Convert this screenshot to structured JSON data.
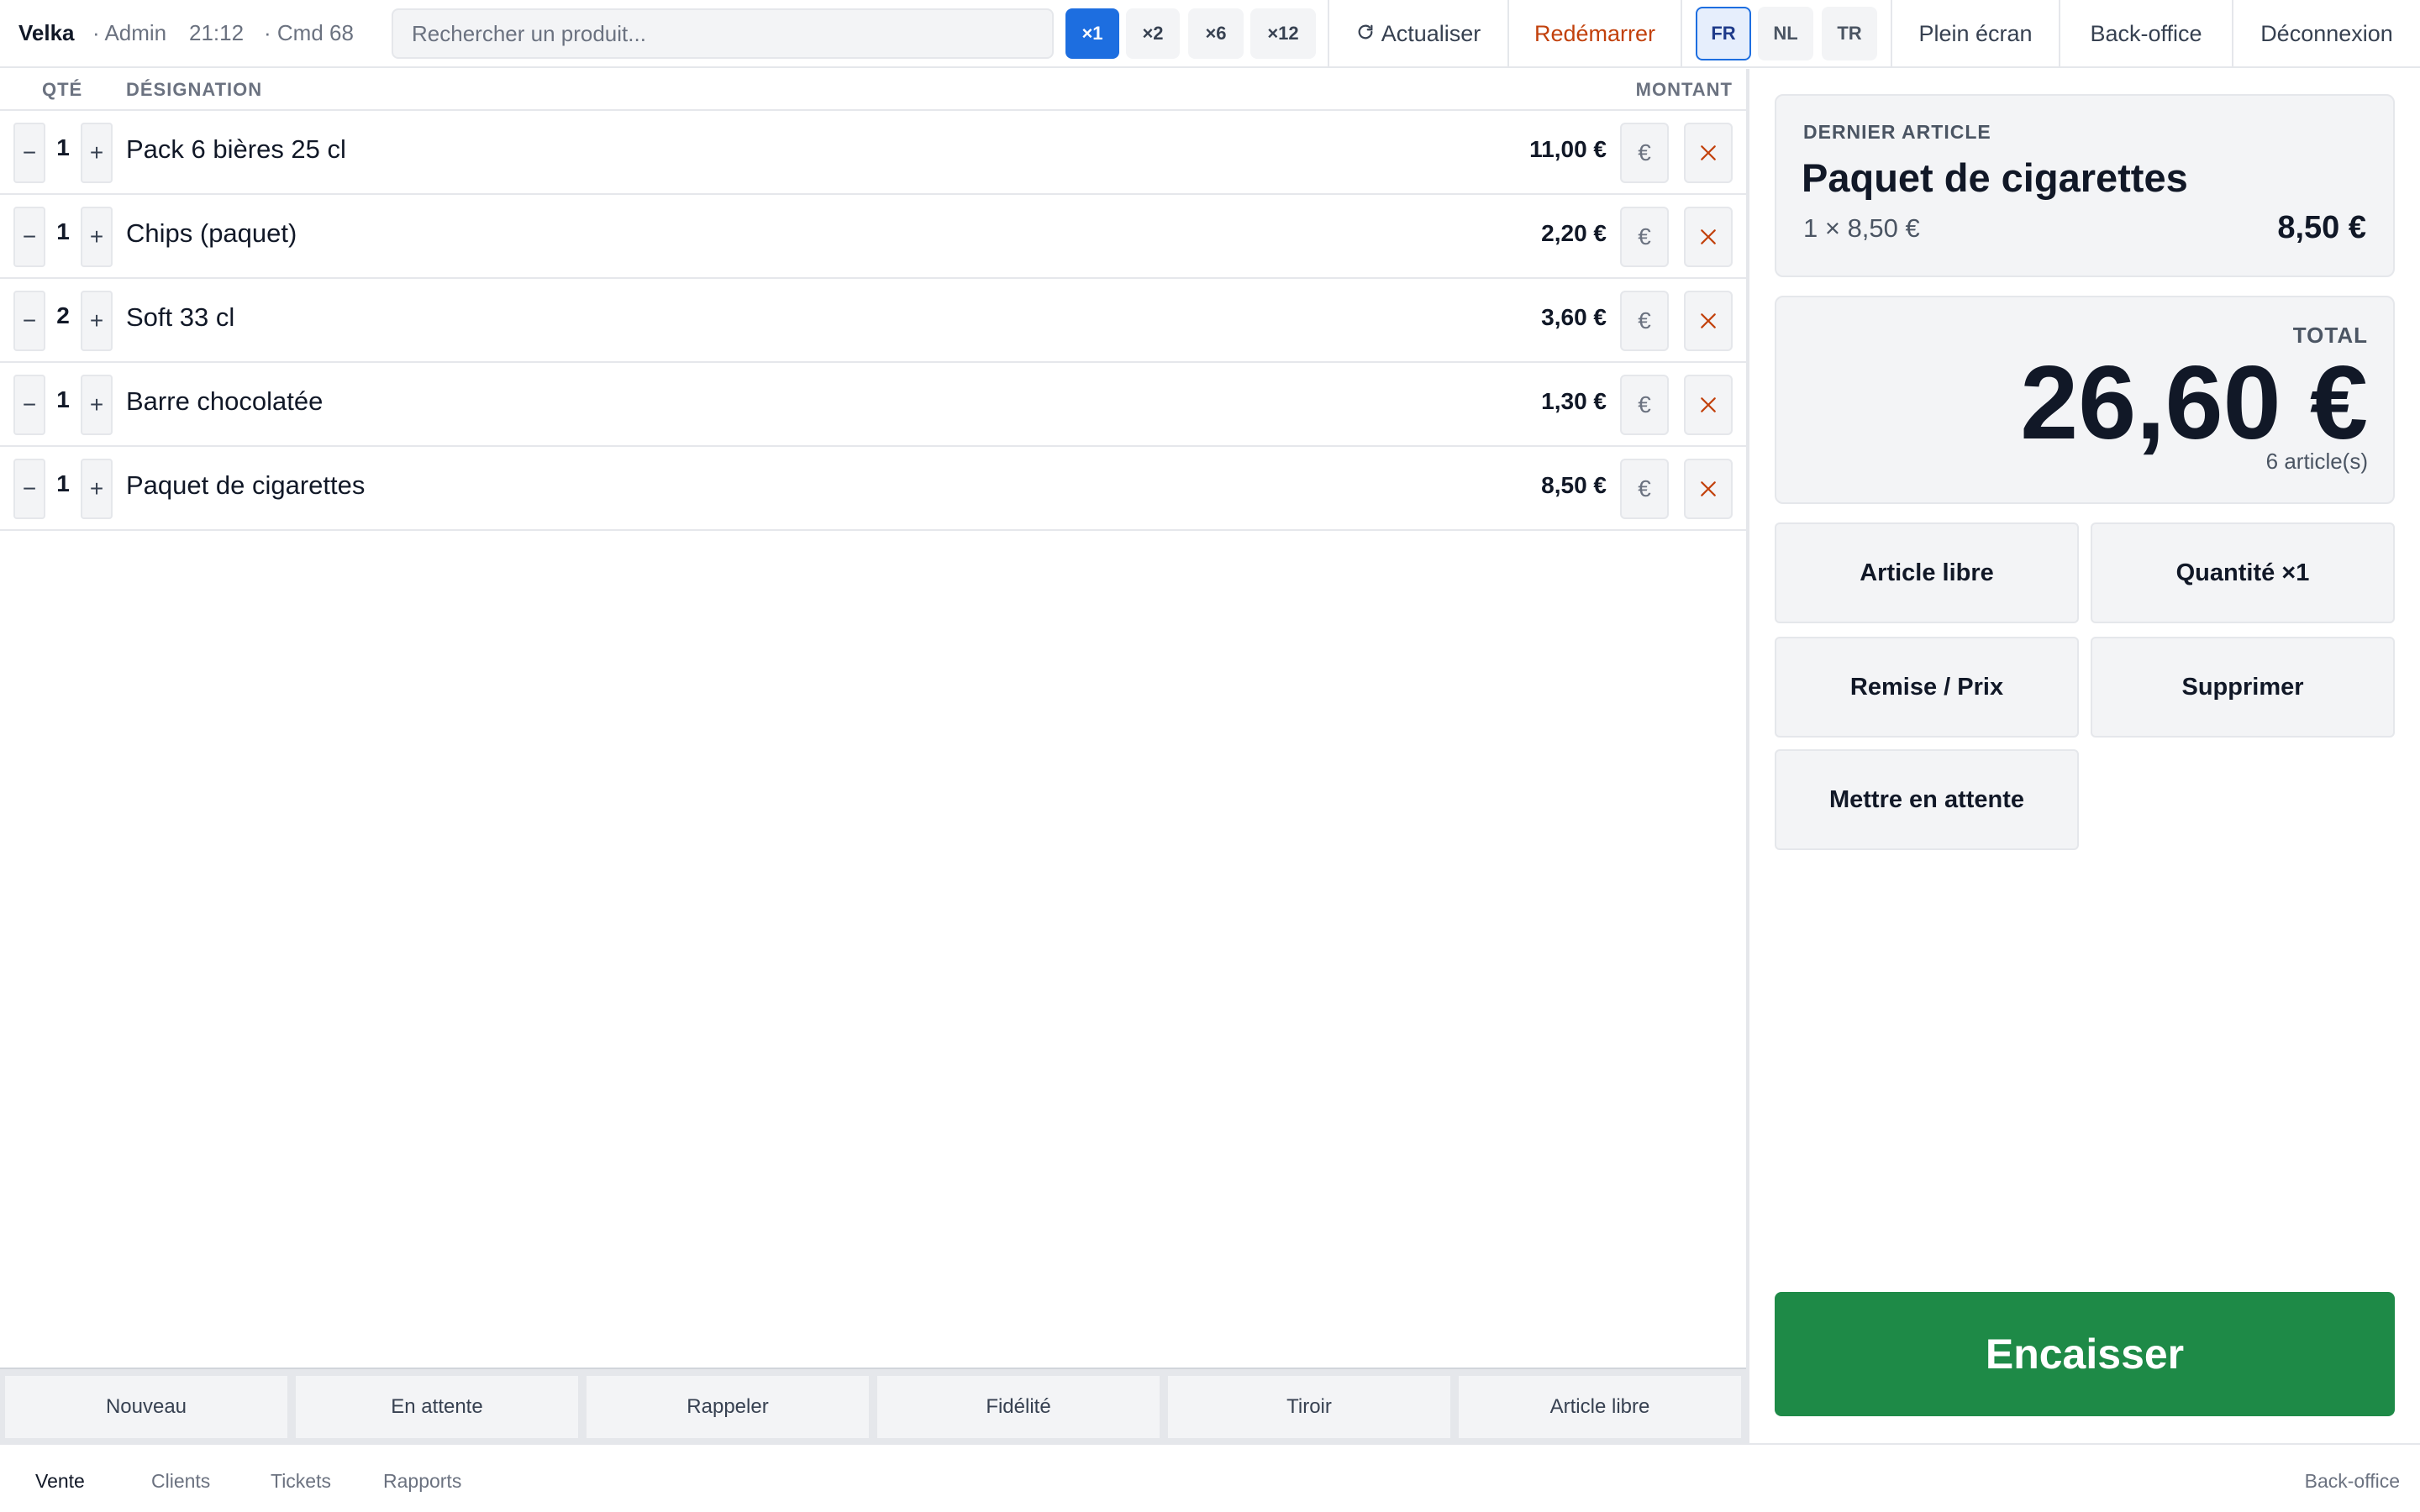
{
  "topbar": {
    "brand": "Velka",
    "user_text": "· Admin",
    "time": "21:12",
    "order_text": "· Cmd 68",
    "search_placeholder": "Rechercher un produit...",
    "multipliers": [
      "×1",
      "×2",
      "×6",
      "×12"
    ],
    "active_multiplier": "×1",
    "refresh_label": "Actualiser",
    "restart_label": "Redémarrer",
    "languages": [
      "FR",
      "NL",
      "TR"
    ],
    "active_language": "FR",
    "fullscreen_label": "Plein écran",
    "backoffice_label": "Back-office",
    "logout_label": "Déconnexion"
  },
  "ticket": {
    "headers": {
      "qty": "QTÉ",
      "designation": "DÉSIGNATION",
      "amount": "MONTANT"
    },
    "decrement_glyph": "−",
    "increment_glyph": "+",
    "price_glyph": "€",
    "lines": [
      {
        "qty": "1",
        "name": "Pack 6 bières 25 cl",
        "amount": "11,00 €"
      },
      {
        "qty": "1",
        "name": "Chips (paquet)",
        "amount": "2,20 €"
      },
      {
        "qty": "2",
        "name": "Soft 33 cl",
        "amount": "3,60 €"
      },
      {
        "qty": "1",
        "name": "Barre chocolatée",
        "amount": "1,30 €"
      },
      {
        "qty": "1",
        "name": "Paquet de cigarettes",
        "amount": "8,50 €"
      }
    ]
  },
  "functions": [
    "Nouveau",
    "En attente",
    "Rappeler",
    "Fidélité",
    "Tiroir",
    "Article libre"
  ],
  "last_article": {
    "label": "DERNIER ARTICLE",
    "name": "Paquet de cigarettes",
    "detail": "1 × 8,50 €",
    "price": "8,50 €"
  },
  "total": {
    "label": "TOTAL",
    "value": "26,60 €",
    "count": "6 article(s)"
  },
  "actions": {
    "free_item": "Article libre",
    "quantity": "Quantité ×1",
    "discount": "Remise / Prix",
    "delete": "Supprimer",
    "hold": "Mettre en attente"
  },
  "pay_label": "Encaisser",
  "nav": {
    "items": [
      "Vente",
      "Clients",
      "Tickets",
      "Rapports"
    ],
    "active": "Vente",
    "backoffice": "Back-office"
  },
  "colors": {
    "accent": "#1d6ee0",
    "pay": "#1e8a47",
    "warning": "#c2410c"
  }
}
